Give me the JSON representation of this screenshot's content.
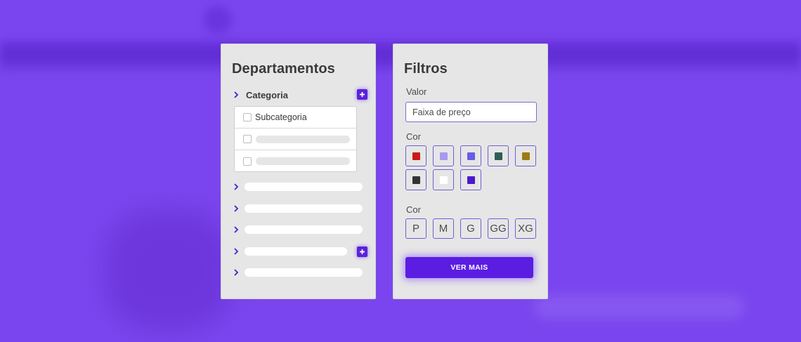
{
  "colors": {
    "background": "#7a45ee",
    "accent": "#5b1de2",
    "panel": "#e6e6e6"
  },
  "departments": {
    "title": "Departamentos",
    "category": {
      "label": "Categoria",
      "expand_icon": "chevron-right-icon",
      "add_icon": "plus-icon",
      "subcategories": [
        {
          "label": "Subcategoria"
        }
      ]
    }
  },
  "filters": {
    "title": "Filtros",
    "value_label": "Valor",
    "price_placeholder": "Faixa de preço",
    "color_label": "Cor",
    "colors": [
      "#cc1a1a",
      "#a79af0",
      "#6a5ce6",
      "#2f5e57",
      "#9c7a14",
      "#333333",
      "#ffffff",
      "#4c18cf"
    ],
    "size_label": "Cor",
    "sizes": [
      "P",
      "M",
      "G",
      "GG",
      "XG"
    ],
    "more_button": "VER MAIS"
  }
}
